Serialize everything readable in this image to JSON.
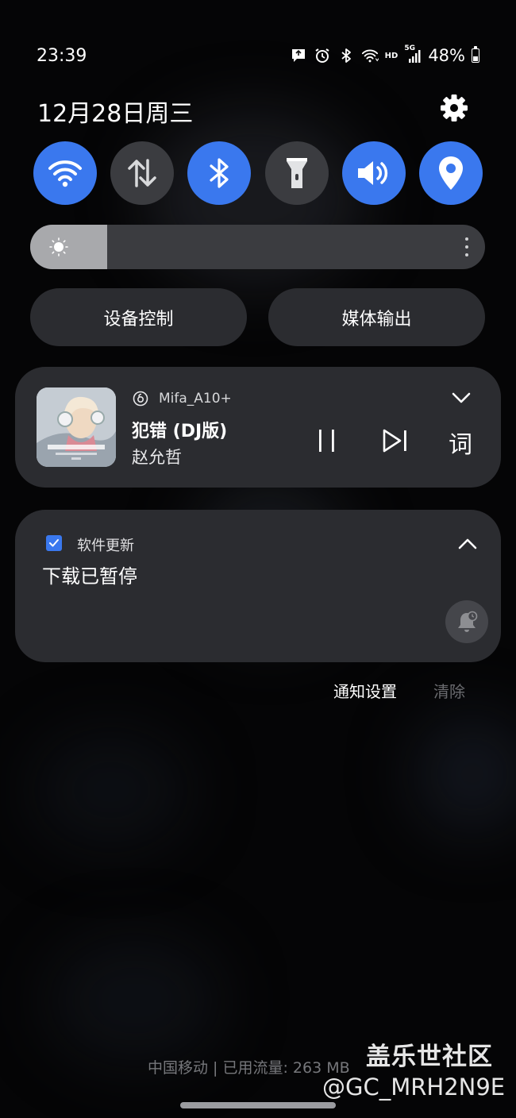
{
  "status_bar": {
    "time": "23:39",
    "network_label": "HD",
    "cellular_label": "5G",
    "battery_percent": "48%",
    "battery_level": 0.48,
    "icons": [
      "chat-notification-icon",
      "alarm-icon",
      "bluetooth-icon",
      "wifi-icon",
      "hd-icon",
      "signal-icon",
      "battery-icon"
    ]
  },
  "header": {
    "date": "12月28日周三",
    "settings_icon": "gear-icon"
  },
  "quick_settings": [
    {
      "name": "wifi",
      "icon": "wifi-icon",
      "active": true
    },
    {
      "name": "mobile-data",
      "icon": "arrows-updown-icon",
      "active": false
    },
    {
      "name": "bluetooth",
      "icon": "bluetooth-icon",
      "active": true
    },
    {
      "name": "flashlight",
      "icon": "flashlight-icon",
      "active": false
    },
    {
      "name": "sound",
      "icon": "speaker-icon",
      "active": true
    },
    {
      "name": "location",
      "icon": "location-pin-icon",
      "active": true
    }
  ],
  "brightness": {
    "level": 0.17
  },
  "buttons": {
    "device_control": "设备控制",
    "media_output": "媒体输出"
  },
  "media_player": {
    "device": "Mifa_A10+",
    "title": "犯错 (DJ版)",
    "artist": "赵允哲",
    "lyrics_label": "词"
  },
  "notification": {
    "app_name": "软件更新",
    "message": "下载已暂停"
  },
  "footer_links": {
    "notification_settings": "通知设置",
    "clear": "清除"
  },
  "carrier_info": "中国移动 | 已用流量: 263 MB",
  "watermark": {
    "site": "盖乐世社区",
    "user": "@GC_MRH2N9E"
  },
  "colors": {
    "accent": "#3a78ee",
    "tile_off": "#3b3c40",
    "card": "#2b2c30"
  }
}
